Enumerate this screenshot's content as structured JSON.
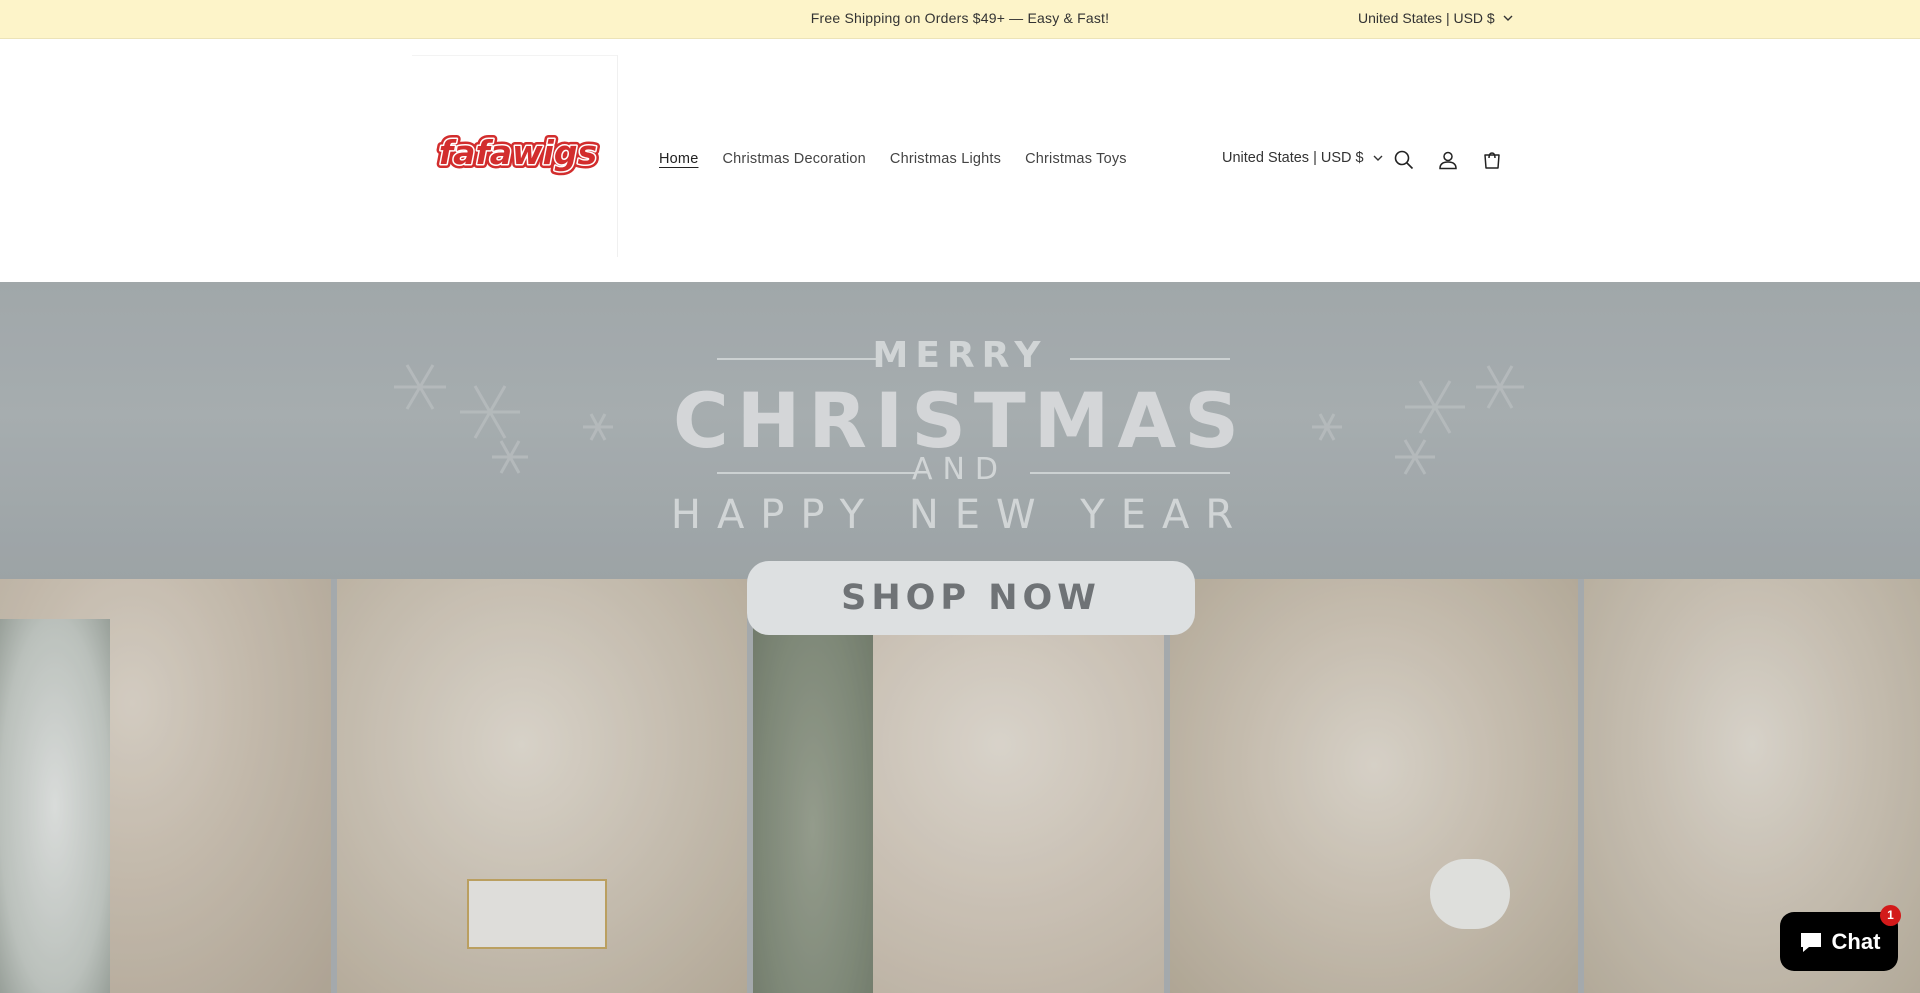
{
  "announcement": {
    "text": "Free Shipping on Orders $49+ — Easy & Fast!",
    "locale": "United States | USD $"
  },
  "header": {
    "logo_text": "fafawigs",
    "nav": [
      {
        "label": "Home",
        "active": true
      },
      {
        "label": "Christmas Decoration",
        "active": false
      },
      {
        "label": "Christmas Lights",
        "active": false
      },
      {
        "label": "Christmas Toys",
        "active": false
      }
    ],
    "locale": "United States | USD $",
    "icons": [
      "search-icon",
      "account-icon",
      "cart-icon"
    ]
  },
  "hero": {
    "line1": "MERRY",
    "line2": "CHRISTMAS",
    "line3": "AND",
    "line4": "HAPPY NEW YEAR",
    "button": "SHOP NOW"
  },
  "chat": {
    "label": "Chat",
    "badge": "1"
  },
  "colors": {
    "announcement_bg": "#fdf4c9",
    "logo_red": "#d22d2d",
    "chat_bg": "#000000",
    "badge_red": "#d31a1a"
  }
}
